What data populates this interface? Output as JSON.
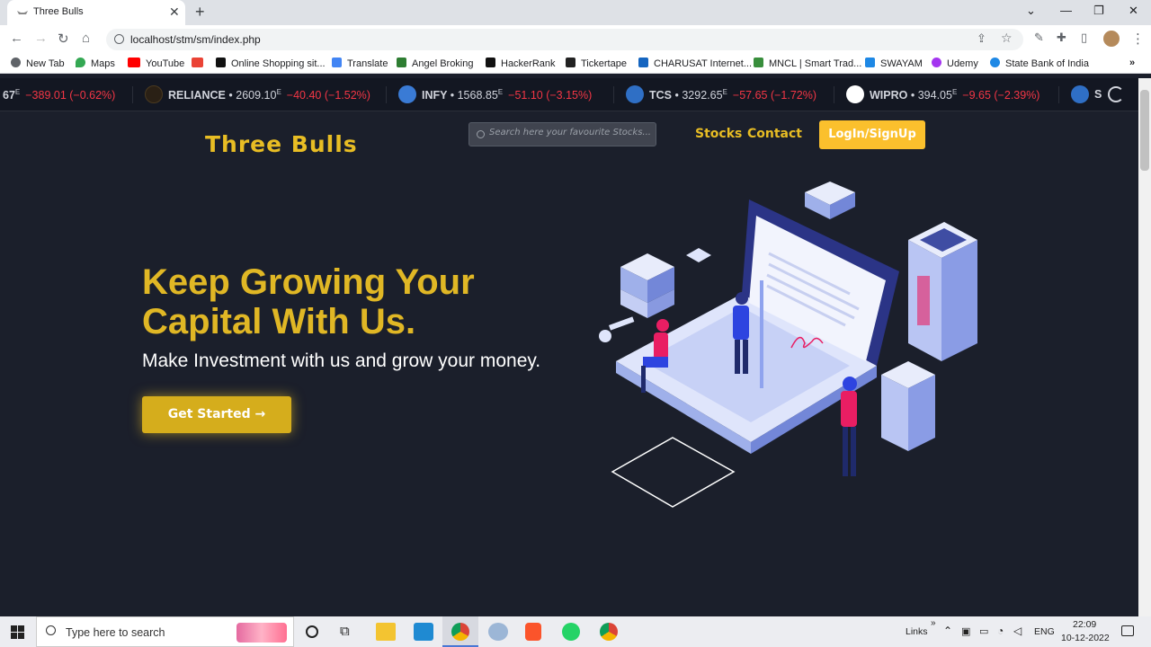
{
  "browser": {
    "tab_title": "Three Bulls",
    "url": "localhost/stm/sm/index.php",
    "bookmarks": [
      "New Tab",
      "Maps",
      "YouTube",
      "Online Shopping sit...",
      "Translate",
      "Angel Broking",
      "HackerRank",
      "Tickertape",
      "CHARUSAT Internet...",
      "MNCL | Smart Trad...",
      "SWAYAM",
      "Udemy",
      "State Bank of India"
    ]
  },
  "ticker": [
    {
      "symbol": "67",
      "price": "",
      "sup": "E",
      "change": "−389.01 (−0.62%)"
    },
    {
      "symbol": "RELIANCE",
      "price": "2609.10",
      "sup": "E",
      "change": "−40.40 (−1.52%)"
    },
    {
      "symbol": "INFY",
      "price": "1568.85",
      "sup": "E",
      "change": "−51.10 (−3.15%)"
    },
    {
      "symbol": "TCS",
      "price": "3292.65",
      "sup": "E",
      "change": "−57.65 (−1.72%)"
    },
    {
      "symbol": "WIPRO",
      "price": "394.05",
      "sup": "E",
      "change": "−9.65 (−2.39%)"
    },
    {
      "symbol": "S",
      "price": "",
      "sup": "",
      "change": ""
    }
  ],
  "site": {
    "brand": "Three Bulls",
    "search_placeholder": "Search here your favourite Stocks...",
    "nav": [
      "Stocks",
      "Contact"
    ],
    "login_label": "LogIn/SignUp",
    "hero_title": "Keep Growing Your Capital With Us.",
    "hero_subtitle": "Make Investment with us and grow your money.",
    "cta_label": "Get Started →"
  },
  "taskbar": {
    "search_placeholder": "Type here to search",
    "links": "Links",
    "lang": "ENG",
    "time": "22:09",
    "date": "10-12-2022"
  },
  "colors": {
    "brand": "#e8bd24",
    "button": "#fbc02d",
    "background": "#1b1f2b",
    "negative": "#f23645"
  }
}
